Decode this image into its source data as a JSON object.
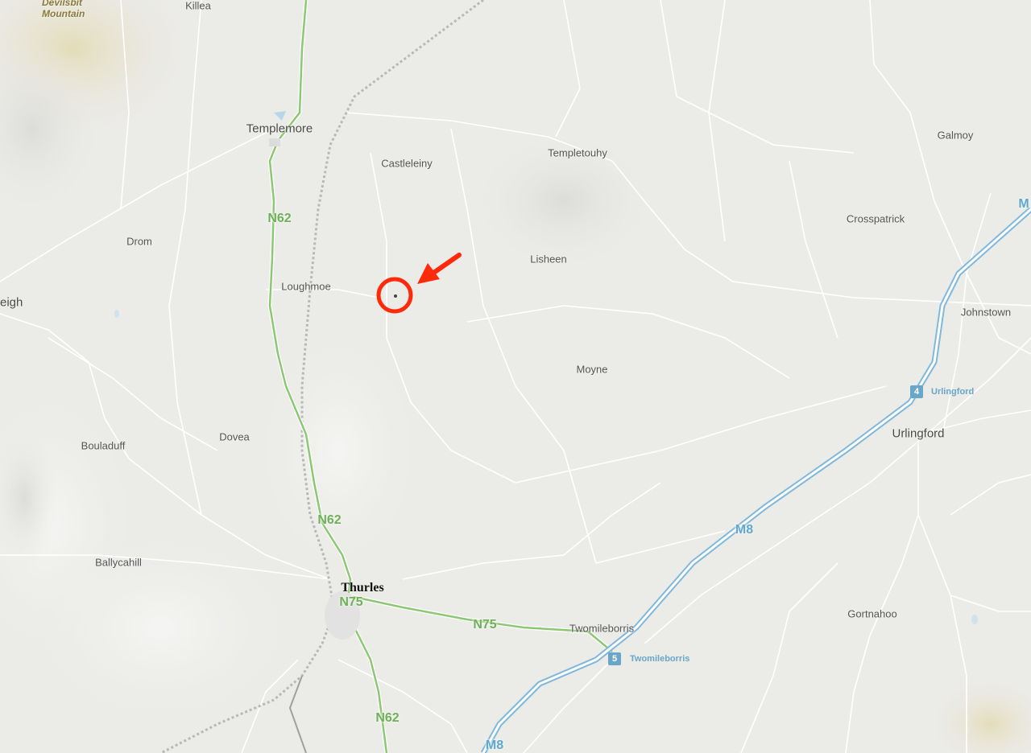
{
  "map": {
    "mountain": "Devilsbit\nMountain",
    "places": {
      "killea": "Killea",
      "templemore": "Templemore",
      "castleleiny": "Castleleiny",
      "templetouhy": "Templetouhy",
      "galmoy": "Galmoy",
      "crosspatrick": "Crosspatrick",
      "drom": "Drom",
      "lisheen": "Lisheen",
      "loughmoe": "Loughmoe",
      "eigh": "eigh",
      "johnstown": "Johnstown",
      "moyne": "Moyne",
      "bouladuff": "Bouladuff",
      "dovea": "Dovea",
      "urlingford": "Urlingford",
      "ballycahill": "Ballycahill",
      "thurles": "Thurles",
      "twomileborris": "Twomileborris",
      "gortnahoo": "Gortnahoo"
    },
    "roads": {
      "n62_top": "N62",
      "n62_mid": "N62",
      "n62_bottom": "N62",
      "n75_thurles": "N75",
      "n75_east": "N75",
      "m8_mid": "M8",
      "m8_bottom": "M8",
      "m_edge": "M"
    },
    "junctions": {
      "j4": {
        "number": "4",
        "label": "Urlingford"
      },
      "j5": {
        "number": "5",
        "label": "Twomileborris"
      }
    },
    "marker": {
      "color": "#ff2a0a"
    },
    "colors": {
      "land": "#ebebe8",
      "national_road": "#8cc874",
      "motorway": "#7fb8dc",
      "minor_road": "#ffffff",
      "railway": "#b5b5b5"
    },
    "icons": {
      "marker_arrow": "arrow-icon",
      "marker_circle": "location-circle-icon"
    }
  }
}
